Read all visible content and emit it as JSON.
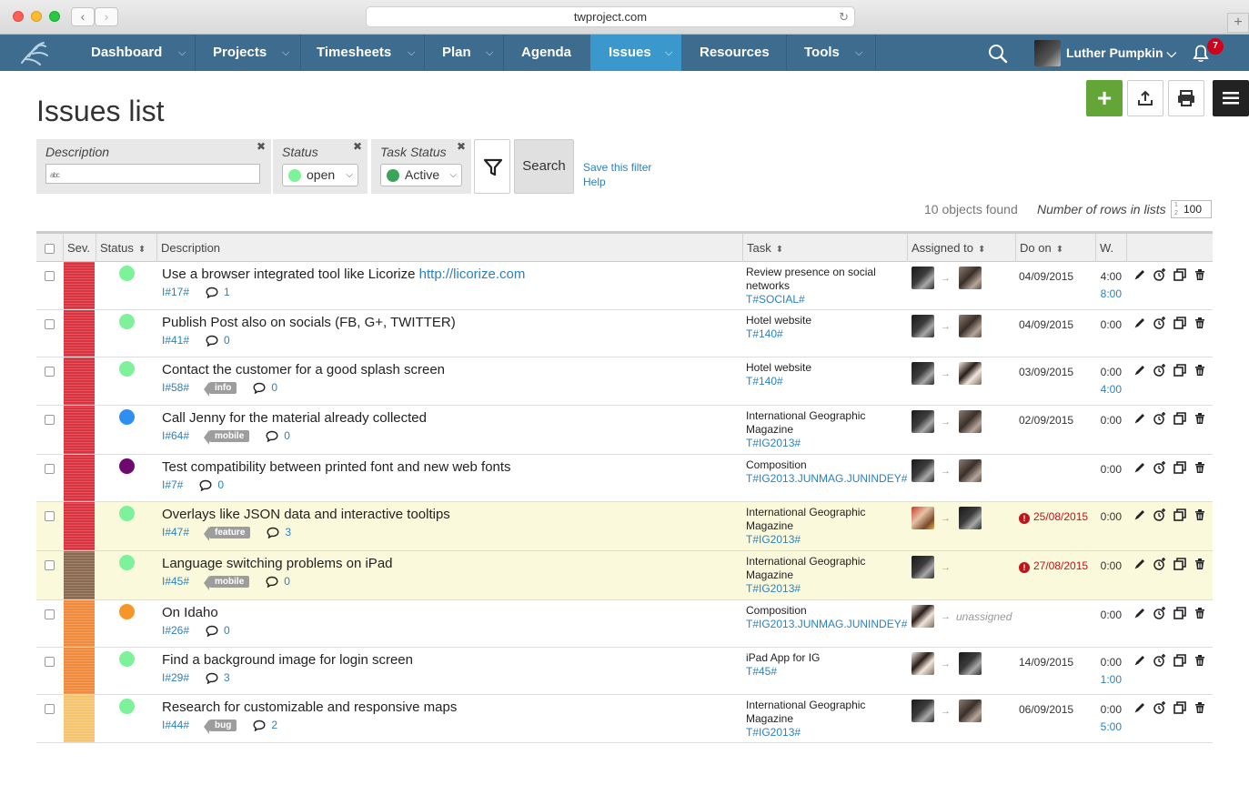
{
  "browser": {
    "url": "twproject.com",
    "back": "‹",
    "forward": "›",
    "newtab": "+"
  },
  "nav": {
    "items": [
      {
        "label": "Dashboard",
        "chev": "⌵"
      },
      {
        "label": "Projects",
        "chev": "⌵"
      },
      {
        "label": "Timesheets",
        "chev": "⌵"
      },
      {
        "label": "Plan",
        "chev": "⌵"
      },
      {
        "label": "Agenda"
      },
      {
        "label": "Issues",
        "chev": "⌵"
      },
      {
        "label": "Resources"
      },
      {
        "label": "Tools",
        "chev": "⌵"
      }
    ],
    "user": "Luther Pumpkin ⌵",
    "notifications": "7"
  },
  "page": {
    "title": "Issues list"
  },
  "toolbar": {
    "add": "+"
  },
  "filters": {
    "description": {
      "label": "Description",
      "value": "",
      "close": "✖"
    },
    "status": {
      "label": "Status",
      "value": "open",
      "color": "#7ef29a",
      "close": "✖"
    },
    "task_status": {
      "label": "Task Status",
      "value": "Active",
      "color": "#3aa55a",
      "close": "✖"
    },
    "search": "Search",
    "save": "Save this filter",
    "help": "Help"
  },
  "summary": {
    "found": "10 objects found",
    "rows_label": "Number of rows in lists",
    "rows_value": "100"
  },
  "table": {
    "headers": {
      "sev": "Sev.",
      "status": "Status",
      "description": "Description",
      "task": "Task",
      "assigned": "Assigned to",
      "doon": "Do on",
      "w": "W."
    },
    "rows": [
      {
        "desc": "Use a browser integrated tool like Licorize ",
        "link": "http://licorize.com",
        "id": "I#17#",
        "tag": "",
        "comments": "1",
        "task": "Review presence on social networks",
        "task_code": "T#SOCIAL#",
        "doon": "04/09/2015",
        "w": "4:00",
        "w2": "8:00"
      },
      {
        "desc": "Publish Post also on socials (FB, G+, TWITTER)",
        "link": "",
        "id": "I#41#",
        "tag": "",
        "comments": "0",
        "task": "Hotel website",
        "task_code": "T#140#",
        "doon": "04/09/2015",
        "w": "0:00",
        "w2": ""
      },
      {
        "desc": "Contact the customer for a good splash screen",
        "link": "",
        "id": "I#58#",
        "tag": "info",
        "comments": "0",
        "task": "Hotel website",
        "task_code": "T#140#",
        "doon": "03/09/2015",
        "w": "0:00",
        "w2": "4:00"
      },
      {
        "desc": "Call Jenny for the material already collected",
        "link": "",
        "id": "I#64#",
        "tag": "mobile",
        "comments": "0",
        "task": "International Geographic Magazine",
        "task_code": "T#IG2013#",
        "doon": "02/09/2015",
        "w": "0:00",
        "w2": ""
      },
      {
        "desc": "Test compatibility between printed font and new web fonts",
        "link": "",
        "id": "I#7#",
        "tag": "",
        "comments": "0",
        "task": "Composition",
        "task_code": "T#IG2013.JUNMAG.JUNINDEY#",
        "doon": "",
        "w": "0:00",
        "w2": ""
      },
      {
        "desc": "Overlays like JSON data and interactive tooltips",
        "link": "",
        "id": "I#47#",
        "tag": "feature",
        "comments": "3",
        "task": "International Geographic Magazine",
        "task_code": "T#IG2013#",
        "doon": "25/08/2015",
        "w": "0:00",
        "w2": ""
      },
      {
        "desc": "Language switching problems on iPad",
        "link": "",
        "id": "I#45#",
        "tag": "mobile",
        "comments": "0",
        "task": "International Geographic Magazine",
        "task_code": "T#IG2013#",
        "doon": "27/08/2015",
        "w": "0:00",
        "w2": ""
      },
      {
        "desc": "On Idaho",
        "link": "",
        "id": "I#26#",
        "tag": "",
        "comments": "0",
        "task": "Composition",
        "task_code": "T#IG2013.JUNMAG.JUNINDEY#",
        "doon": "",
        "w": "0:00",
        "w2": "",
        "unassigned": "unassigned"
      },
      {
        "desc": "Find a background image for login screen",
        "link": "",
        "id": "I#29#",
        "tag": "",
        "comments": "3",
        "task": "iPad App for IG",
        "task_code": "T#45#",
        "doon": "14/09/2015",
        "w": "0:00",
        "w2": "1:00"
      },
      {
        "desc": "Research for customizable and responsive maps",
        "link": "",
        "id": "I#44#",
        "tag": "bug",
        "comments": "2",
        "task": "International Geographic Magazine",
        "task_code": "T#IG2013#",
        "doon": "06/09/2015",
        "w": "0:00",
        "w2": "5:00"
      }
    ]
  },
  "colors": {
    "nav": "#3d6c8e",
    "active": "#3a98cc",
    "sev_high": "#d9333f",
    "sev_brown": "#8b6a52",
    "sev_orange": "#f08a3c",
    "sev_light": "#f5c46e",
    "open": "#7ef29a",
    "blue": "#2d8ff0",
    "purple": "#6e0a6e",
    "orange": "#f5962a"
  }
}
